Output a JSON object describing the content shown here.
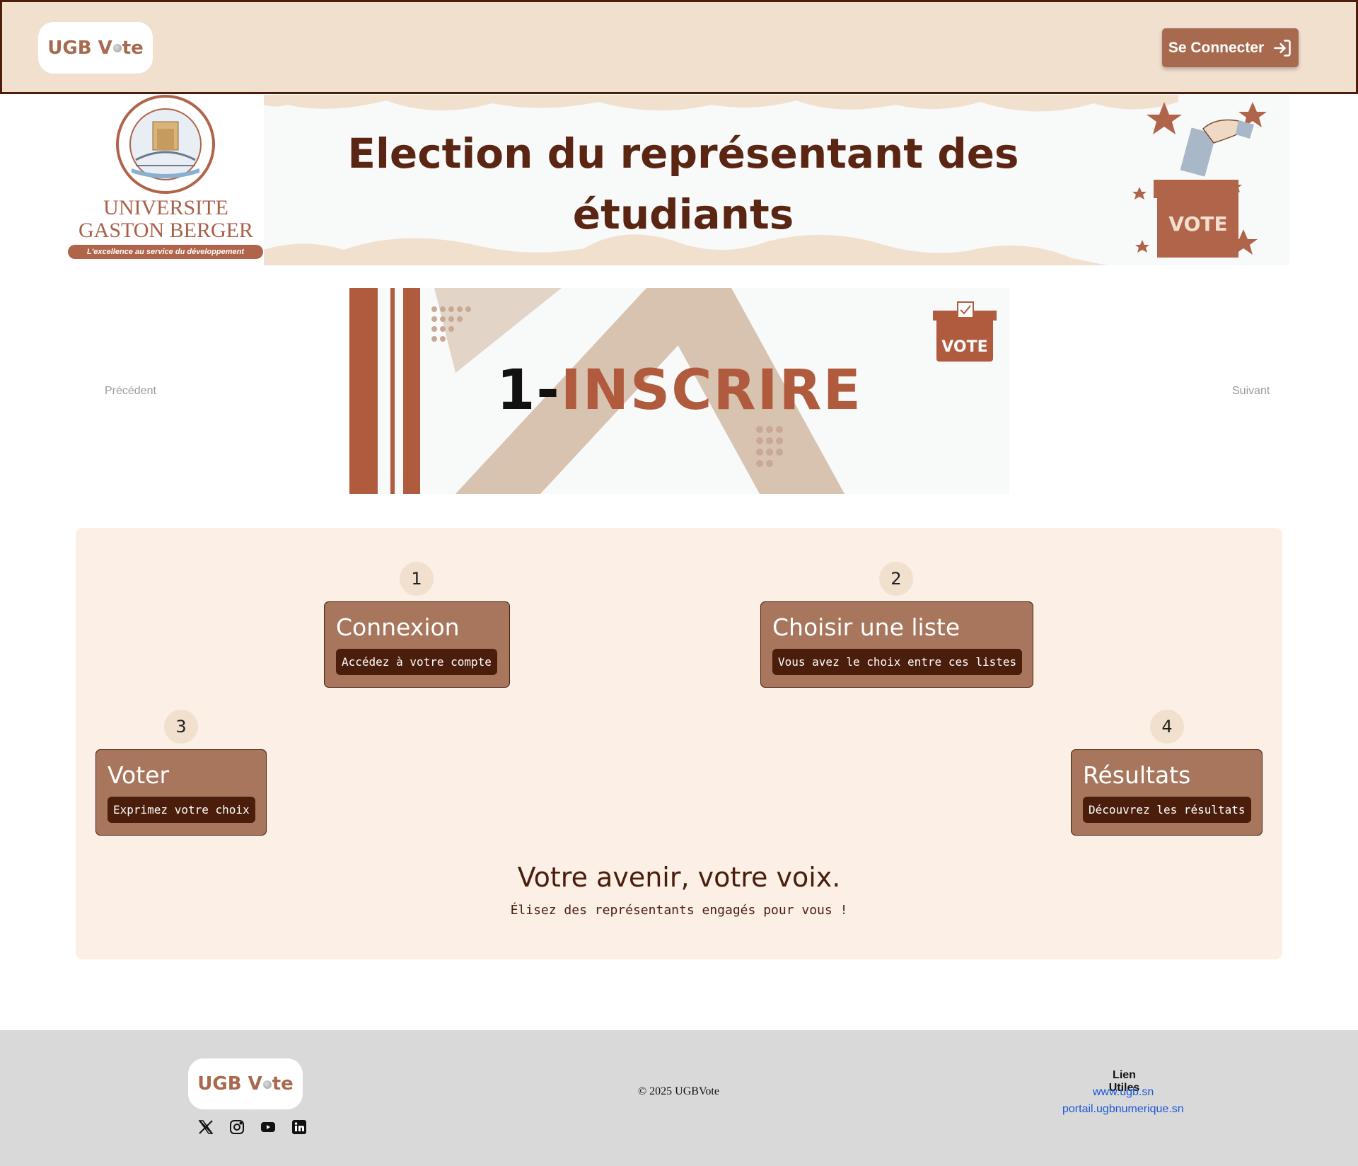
{
  "header": {
    "logo_main": "UGB",
    "logo_v": "V",
    "logo_end": "te",
    "login_label": "Se Connecter"
  },
  "banner": {
    "title_line1": "Election du représentant des",
    "title_line2": "étudiants",
    "univ_line1": "UNIVERSITE",
    "univ_line2": "GASTON BERGER",
    "univ_tagline": "L'excellence au service du développement",
    "vote_box_label": "VOTE"
  },
  "carousel": {
    "prev_label": "Précédent",
    "next_label": "Suivant",
    "slide_number": "1-",
    "slide_text": "INSCRIRE",
    "slide_box_label": "VOTE"
  },
  "steps": [
    {
      "number": "1",
      "title": "Connexion",
      "description": "Accédez à votre compte"
    },
    {
      "number": "2",
      "title": "Choisir une liste",
      "description": "Vous avez le choix entre ces listes"
    },
    {
      "number": "3",
      "title": "Voter",
      "description": "Exprimez votre choix"
    },
    {
      "number": "4",
      "title": "Résultats",
      "description": "Découvrez les résultats"
    }
  ],
  "tagline": "Votre avenir, votre voix.",
  "subline": "Élisez des représentants engagés pour vous !",
  "footer": {
    "logo_main": "UGB",
    "logo_v": "V",
    "logo_end": "te",
    "socials": [
      "x-icon",
      "instagram-icon",
      "youtube-icon",
      "linkedin-icon"
    ],
    "copyright": "© 2025 UGBVote",
    "links_title": "Lien Utiles",
    "links": [
      "www.ugb.sn",
      "portail.ugbnumerique.sn"
    ]
  },
  "colors": {
    "brand_dark": "#4a1e0b",
    "brand": "#a86a4e",
    "header_bg": "#f2e0cf",
    "panel_bg": "#fcefe6",
    "footer_bg": "#d9d9d9",
    "link": "#1a57d6"
  }
}
